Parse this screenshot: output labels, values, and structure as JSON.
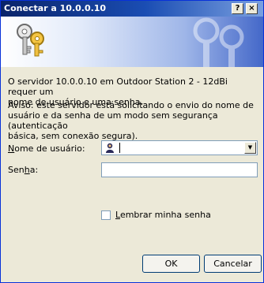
{
  "window": {
    "title": "Conectar a 10.0.0.10",
    "help_label": "?",
    "close_label": "×"
  },
  "banner": {
    "icon": "keys-icon"
  },
  "message": {
    "line1": "O servidor 10.0.0.10 em Outdoor Station 2 - 12dBi requer um",
    "line2": "nome de usuário e uma senha.",
    "warning1": "Aviso: este servidor está solicitando o envio do nome de",
    "warning2": "usuário e da senha de um modo sem segurança (autenticação",
    "warning3": "básica, sem conexão segura)."
  },
  "form": {
    "username_label_pre": "N",
    "username_label_rest": "ome de usuário:",
    "username_value": "",
    "username_icon": "user-icon",
    "password_label_pre": "Sen",
    "password_label_key": "h",
    "password_label_post": "a:",
    "password_value": "",
    "remember_key": "L",
    "remember_rest": "embrar minha senha",
    "remember_checked": false
  },
  "buttons": {
    "ok_label": "OK",
    "cancel_label": "Cancelar"
  },
  "colors": {
    "titlebar_start": "#0a246a",
    "titlebar_end": "#7aa0e0",
    "dialog_bg": "#ece9d8"
  }
}
